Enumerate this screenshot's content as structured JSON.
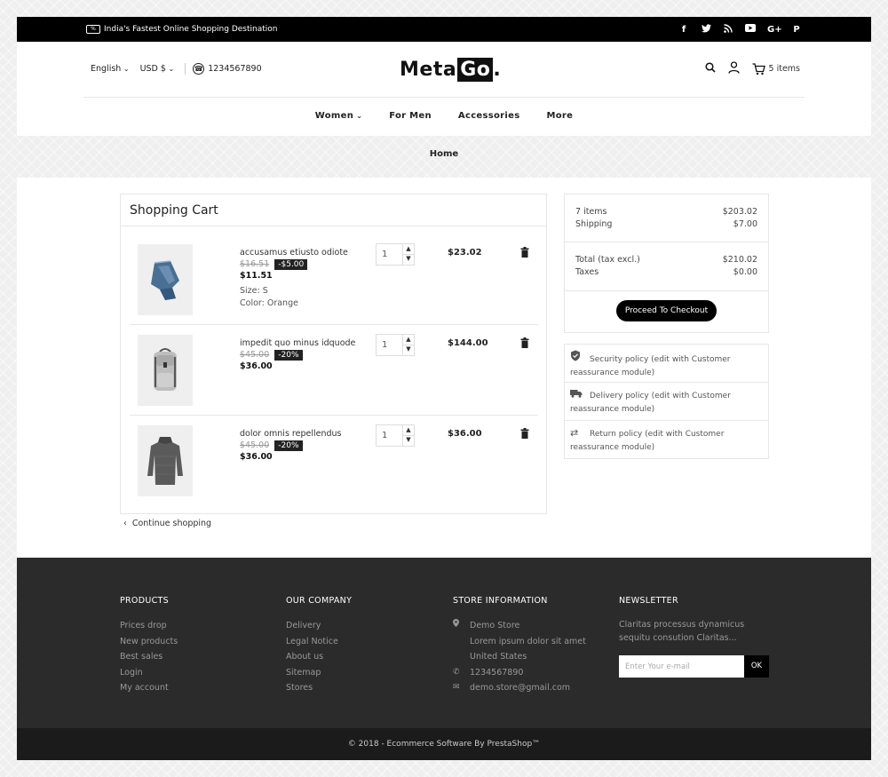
{
  "topbar": {
    "promo_text": "India's Fastest Online Shopping Destination",
    "social_icons": [
      "facebook-icon",
      "twitter-icon",
      "rss-icon",
      "youtube-icon",
      "google-plus-icon",
      "pinterest-icon"
    ]
  },
  "header": {
    "language": "English",
    "currency": "USD $",
    "phone": "1234567890",
    "logo_main": "Meta",
    "logo_box": "Go",
    "logo_dot": ".",
    "cart_count": "5 items"
  },
  "nav": {
    "items": [
      "Women",
      "For Men",
      "Accessories",
      "More"
    ]
  },
  "breadcrumb": {
    "home": "Home"
  },
  "cart": {
    "title": "Shopping Cart",
    "items": [
      {
        "name": "accusamus etiusto odiote",
        "old_price": "$16.51",
        "discount": "-$5.00",
        "price": "$11.51",
        "size": "Size: S",
        "color": "Color: Orange",
        "qty": "1",
        "total": "$23.02"
      },
      {
        "name": "impedit quo minus idquode",
        "old_price": "$45.00",
        "discount": "-20%",
        "price": "$36.00",
        "qty": "1",
        "total": "$144.00"
      },
      {
        "name": "dolor omnis repellendus",
        "old_price": "$45.00",
        "discount": "-20%",
        "price": "$36.00",
        "qty": "1",
        "total": "$36.00"
      }
    ],
    "continue": "Continue shopping"
  },
  "summary": {
    "items_label": "7 items",
    "items_value": "$203.02",
    "shipping_label": "Shipping",
    "shipping_value": "$7.00",
    "total_label": "Total (tax excl.)",
    "total_value": "$210.02",
    "taxes_label": "Taxes",
    "taxes_value": "$0.00",
    "checkout": "Proceed To Checkout"
  },
  "reassurance": [
    "Security policy (edit with Customer reassurance module)",
    "Delivery policy (edit with Customer reassurance module)",
    "Return policy (edit with Customer reassurance module)"
  ],
  "footer": {
    "products_title": "PRODUCTS",
    "products": [
      "Prices drop",
      "New products",
      "Best sales",
      "Login",
      "My account"
    ],
    "company_title": "OUR COMPANY",
    "company": [
      "Delivery",
      "Legal Notice",
      "About us",
      "Sitemap",
      "Stores"
    ],
    "store_title": "STORE INFORMATION",
    "store_name": "Demo Store",
    "store_line2": "Lorem ipsum dolor sit amet",
    "store_line3": "United States",
    "store_phone": "1234567890",
    "store_email": "demo.store@gmail.com",
    "newsletter_title": "NEWSLETTER",
    "newsletter_text": "Claritas processus dynamicus sequitu consution Claritas...",
    "newsletter_placeholder": "Enter Your e-mail",
    "newsletter_ok": "OK",
    "copyright": "© 2018 - Ecommerce Software By PrestaShop™"
  }
}
